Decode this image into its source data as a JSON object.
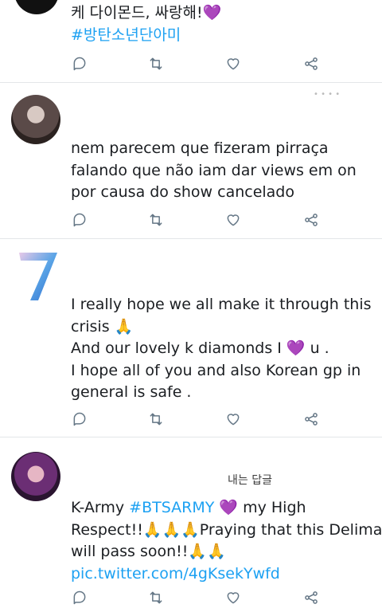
{
  "tweets": [
    {
      "lines": [
        "케 다이몬드, 싸랑해!💜"
      ],
      "link_lines": [
        "#방탄소년단아미"
      ]
    },
    {
      "lines": [
        "nem parecem que fizeram pirraça",
        "falando que não iam dar views em on",
        "por causa do show cancelado"
      ],
      "link_lines": []
    },
    {
      "lines": [
        "I really hope we all make it through this",
        "crisis 🙏",
        "And our lovely k diamonds I 💜 u .",
        "I hope all of you and also Korean gp in",
        "general is safe ."
      ],
      "link_lines": []
    },
    {
      "reply_label": "내는 답글",
      "line1_prefix": "K-Army ",
      "line1_hashtag": "#BTSARMY",
      "line1_suffix": " 💜 my High",
      "lines": [
        "Respect!!🙏🙏🙏Praying that this Delima",
        "will pass soon!!🙏🙏"
      ],
      "link": "pic.twitter.com/4gKsekYwfd"
    }
  ],
  "icons": [
    "reply-icon",
    "retweet-icon",
    "like-icon",
    "share-icon"
  ],
  "colors": {
    "link": "#1da1f2",
    "icon": "#657786",
    "divider": "#e3e6e8"
  }
}
